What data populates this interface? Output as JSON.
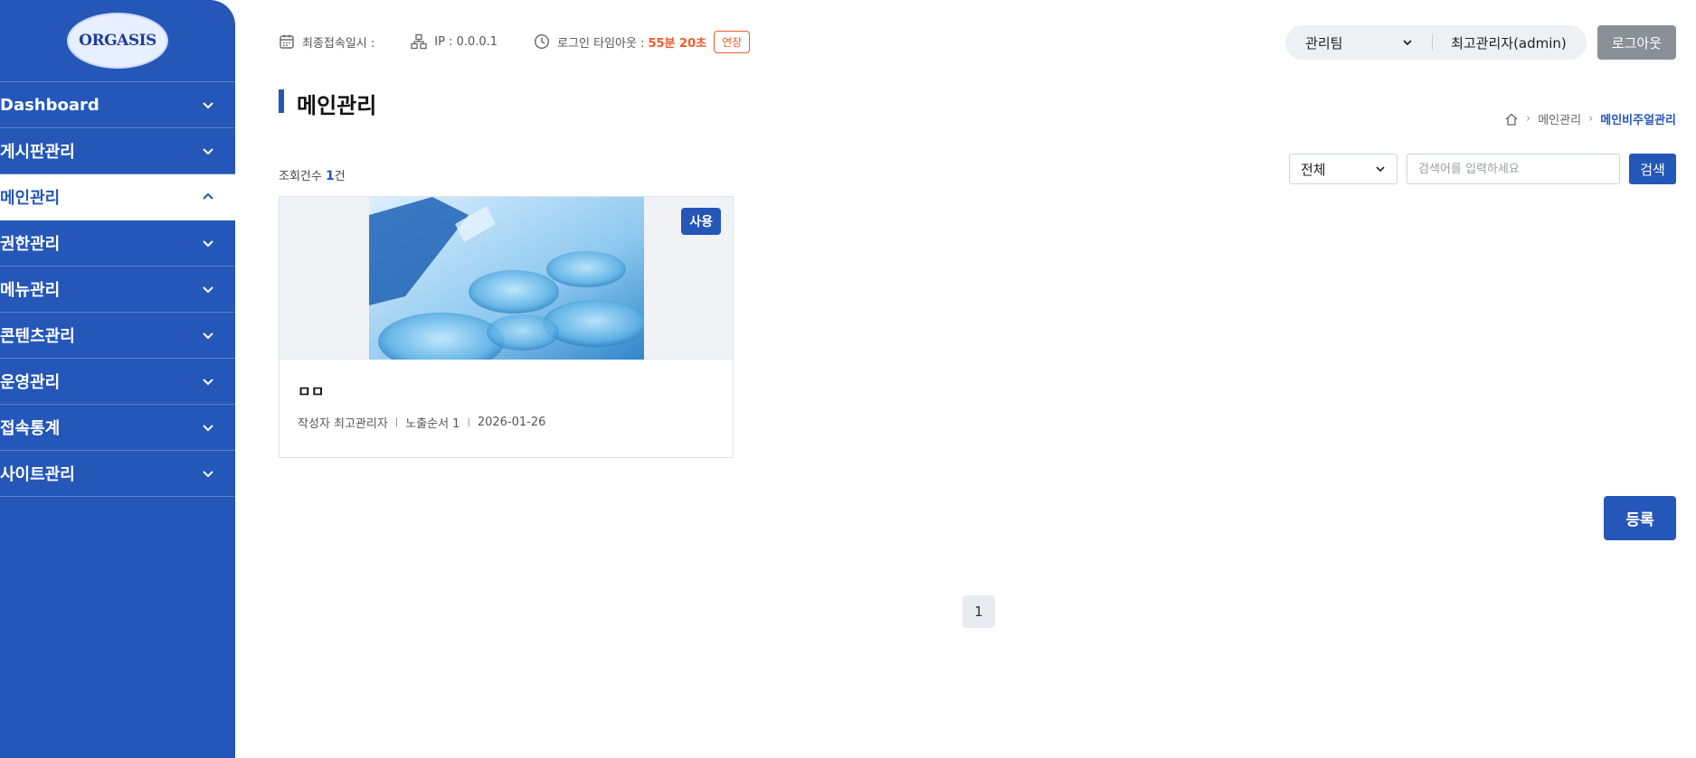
{
  "sidebar": {
    "logo_text": "ORGASIS",
    "items": [
      {
        "label": "Dashboard",
        "expanded": false
      },
      {
        "label": "게시판관리",
        "expanded": false
      },
      {
        "label": "메인관리",
        "expanded": true
      },
      {
        "label": "권한관리",
        "expanded": false
      },
      {
        "label": "메뉴관리",
        "expanded": false
      },
      {
        "label": "콘텐츠관리",
        "expanded": false
      },
      {
        "label": "운영관리",
        "expanded": false
      },
      {
        "label": "접속통계",
        "expanded": false
      },
      {
        "label": "사이트관리",
        "expanded": false
      }
    ]
  },
  "topbar": {
    "last_login_label": "최종접속일시 :",
    "ip_label": "IP : 0.0.0.1",
    "timeout_label": "로그인 타임아웃 :",
    "timeout_value": "55분 20초",
    "extend_label": "연장",
    "team_select": "관리팀",
    "user_name": "최고관리자(admin)",
    "logout_label": "로그아웃"
  },
  "page": {
    "title": "메인관리",
    "breadcrumb": {
      "level1": "메인관리",
      "current": "메인비주얼관리"
    }
  },
  "list": {
    "count_label": "조회건수",
    "count_value": "1",
    "count_unit": "건",
    "filter_select": "전체",
    "search_placeholder": "검색어를 입력하세요",
    "search_button": "검색"
  },
  "cards": [
    {
      "badge": "사용",
      "title": "ㅁㅁ",
      "author_label": "작성자 최고관리자",
      "order_label": "노출순서 1",
      "date": "2026-01-26"
    }
  ],
  "register_button": "등록",
  "pagination": {
    "current": "1"
  },
  "colors": {
    "primary": "#2457b8",
    "accent": "#ef5a2b"
  }
}
